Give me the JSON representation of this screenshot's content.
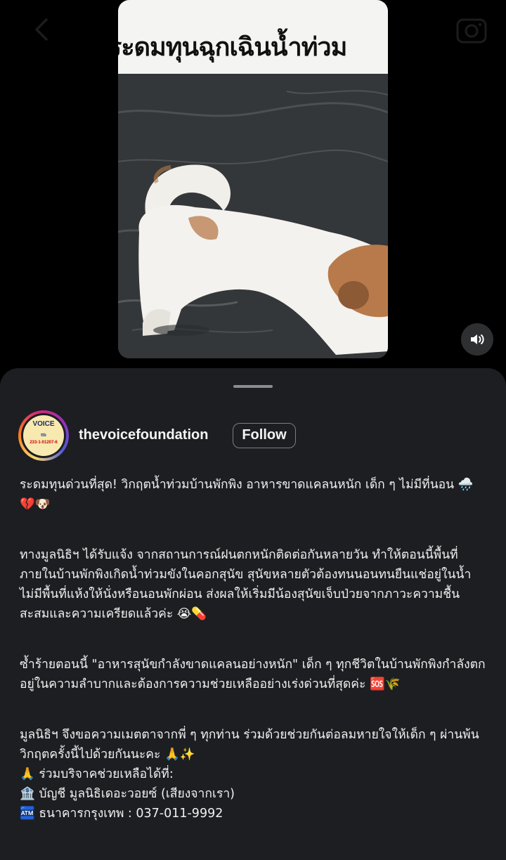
{
  "video": {
    "overlay_caption": "ระดมทุนฉุกเฉินน้ำท่วม"
  },
  "icons": {
    "back": "chevron-left-icon",
    "camera": "camera-icon",
    "sound": "speaker-icon"
  },
  "post": {
    "username": "thevoicefoundation",
    "follow_label": "Follow",
    "avatar": {
      "logo_text": "VOICE",
      "bank_text": "ttb",
      "account_text": "233-1-01207-6"
    },
    "caption": {
      "p1": "ระดมทุนด่วนที่สุด! วิกฤตน้ำท่วมบ้านพักพิง อาหารขาดแคลนหนัก เด็ก ๆ ไม่มีที่นอน 🌧️💔🐶",
      "p2": "ทางมูลนิธิฯ ได้รับแจ้ง จากสถานการณ์ฝนตกหนักติดต่อกันหลายวัน ทำให้ตอนนี้พื้นที่ภายในบ้านพักพิงเกิดน้ำท่วมขังในคอกสุนัข สุนัขหลายตัวต้องทนนอนทนยืนแช่อยู่ในน้ำ ไม่มีพื้นที่แห้งให้นั่งหรือนอนพักผ่อน ส่งผลให้เริ่มมีน้องสุนัขเจ็บป่วยจากภาวะความชื้นสะสมและความเครียดแล้วค่ะ 😭💊",
      "p3": "ซ้ำร้ายตอนนี้ \"อาหารสุนัขกำลังขาดแคลนอย่างหนัก\" เด็ก ๆ ทุกชีวิตในบ้านพักพิงกำลังตกอยู่ในความลำบากและต้องการความช่วยเหลืออย่างเร่งด่วนที่สุดค่ะ 🆘🌾",
      "p4": "มูลนิธิฯ จึงขอความเมตตาจากพี่ ๆ ทุกท่าน ร่วมด้วยช่วยกันต่อลมหายใจให้เด็ก ๆ ผ่านพ้นวิกฤตครั้งนี้ไปด้วยกันนะคะ 🙏✨",
      "l1": "🙏 ร่วมบริจาคช่วยเหลือได้ที่:",
      "l2": "🏦 บัญชี มูลนิธิเดอะวอยซ์ (เสียงจากเรา)",
      "l3": "🏧 ธนาคารกรุงเทพ : 037-011-9992"
    }
  }
}
